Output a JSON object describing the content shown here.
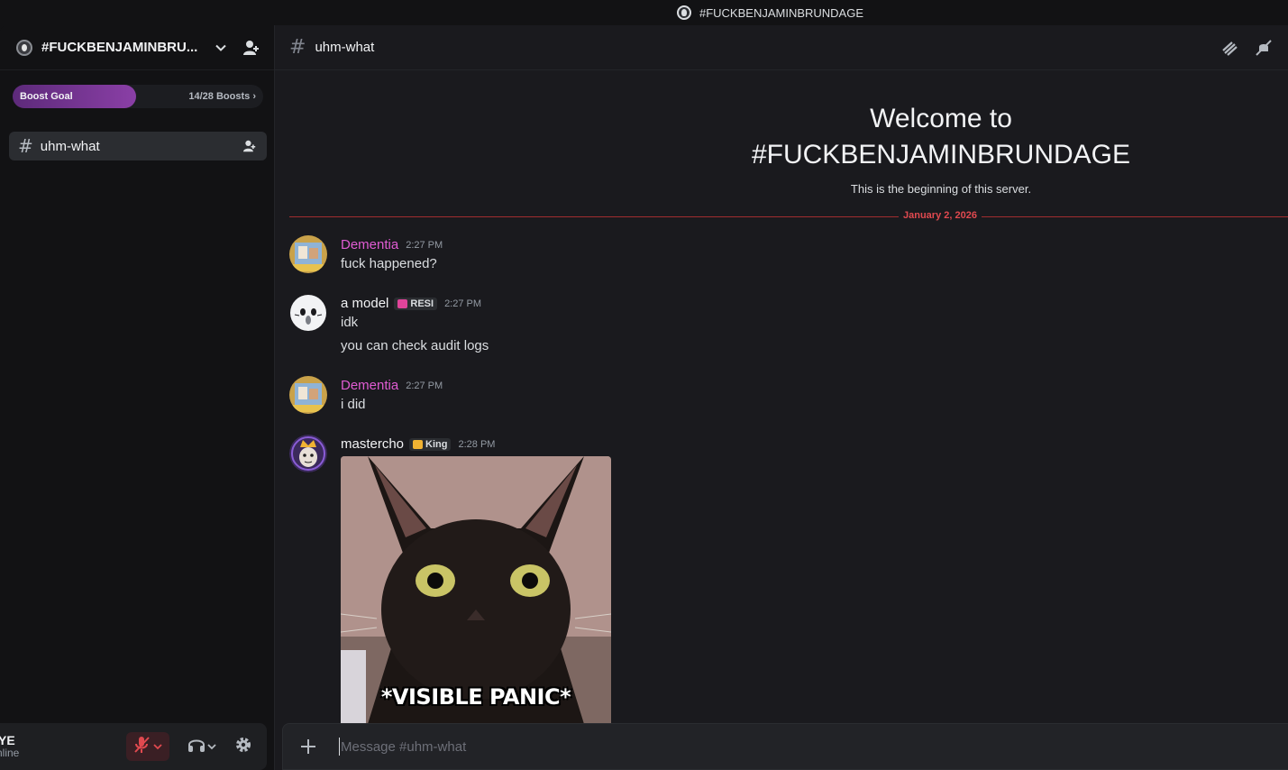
{
  "window": {
    "title": "#FUCKBENJAMINBRUNDAGE"
  },
  "server": {
    "name": "#FUCKBENJAMINBRU..."
  },
  "boost": {
    "label": "Boost Goal",
    "count": "14/28 Boosts",
    "chevron": "›",
    "progress": 0.5
  },
  "channels": [
    {
      "name": "uhm-what"
    }
  ],
  "channel_header": {
    "hash": "#",
    "name": "uhm-what"
  },
  "welcome": {
    "line1": "Welcome to",
    "line2": "#FUCKBENJAMINBRUNDAGE",
    "subtitle": "This is the beginning of this server."
  },
  "divider_date": "January 2, 2026",
  "messages": [
    {
      "author": "Dementia",
      "author_color": "#e05cd3",
      "time": "2:27 PM",
      "lines": [
        "fuck happened?"
      ]
    },
    {
      "author": "a model",
      "author_color": "#f2f3f5",
      "tag": "RESI",
      "tag_color": "#e0449a",
      "time": "2:27 PM",
      "lines": [
        "idk",
        "you can check audit logs"
      ]
    },
    {
      "author": "Dementia",
      "author_color": "#e05cd3",
      "time": "2:27 PM",
      "lines": [
        "i did"
      ]
    },
    {
      "author": "mastercho",
      "author_color": "#f2f3f5",
      "tag": "King",
      "tag_color": "#f0b232",
      "time": "2:28 PM",
      "image_caption": "*VISIBLE PANIC*"
    }
  ],
  "user": {
    "name": "YE",
    "status": "nline"
  },
  "composer": {
    "placeholder": "Message #uhm-what"
  },
  "icons": {
    "server": "server-icon",
    "chevron": "chevron-down-icon",
    "invite": "add-member-icon",
    "threads": "threads-icon",
    "mute": "bell-muted-icon",
    "mic": "mic-muted-icon",
    "headphones": "headphones-icon",
    "settings": "gear-icon",
    "plus": "plus-icon"
  }
}
